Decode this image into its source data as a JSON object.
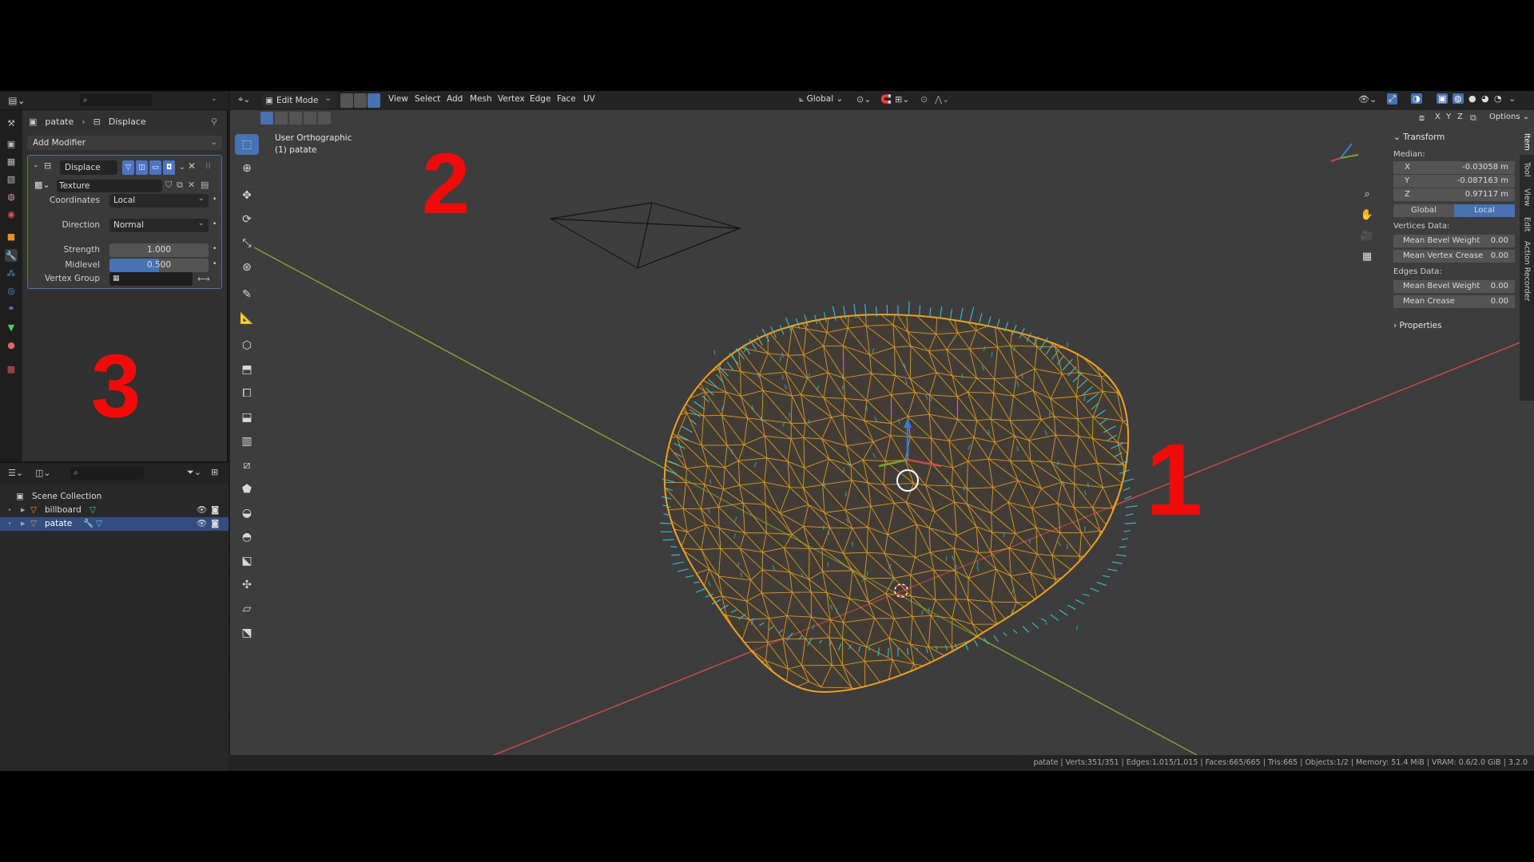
{
  "properties": {
    "breadcrumb": {
      "object": "patate",
      "modifier": "Displace"
    },
    "add_modifier_label": "Add Modifier",
    "modifier": {
      "name": "Displace",
      "texture_label": "Texture",
      "coordinates_label": "Coordinates",
      "coordinates_value": "Local",
      "direction_label": "Direction",
      "direction_value": "Normal",
      "strength_label": "Strength",
      "strength_value": "1.000",
      "midlevel_label": "Midlevel",
      "midlevel_value": "0.500",
      "midlevel_fraction": 0.5,
      "vertex_group_label": "Vertex Group"
    }
  },
  "outliner": {
    "scene_collection": "Scene Collection",
    "items": [
      {
        "name": "billboard",
        "selected": false
      },
      {
        "name": "patate",
        "selected": true
      }
    ]
  },
  "viewport": {
    "mode": "Edit Mode",
    "menus": [
      "View",
      "Select",
      "Add",
      "Mesh",
      "Vertex",
      "Edge",
      "Face",
      "UV"
    ],
    "transform_orientation": "Global",
    "options_label": "Options",
    "axis_labels": [
      "X",
      "Y",
      "Z"
    ],
    "view_name": "User Orthographic",
    "object_label": "(1) patate"
  },
  "annotations": {
    "one": "1",
    "two": "2",
    "three": "3"
  },
  "npanel": {
    "transform_header": "Transform",
    "median_label": "Median:",
    "x_label": "X",
    "x_value": "-0.03058 m",
    "y_label": "Y",
    "y_value": "-0.087163 m",
    "z_label": "Z",
    "z_value": "0.97117 m",
    "global_label": "Global",
    "local_label": "Local",
    "vertices_data_label": "Vertices Data:",
    "mean_bevel_weight_label": "Mean Bevel Weight",
    "mean_bevel_weight_value": "0.00",
    "mean_vertex_crease_label": "Mean Vertex Crease",
    "mean_vertex_crease_value": "0.00",
    "edges_data_label": "Edges Data:",
    "edge_bevel_weight_label": "Mean Bevel Weight",
    "edge_bevel_weight_value": "0.00",
    "mean_crease_label": "Mean Crease",
    "mean_crease_value": "0.00",
    "properties_label": "Properties",
    "side_tabs": [
      "Item",
      "Tool",
      "View",
      "Edit",
      "Action Recorder"
    ]
  },
  "statusbar": {
    "text": "patate | Verts:351/351 | Edges:1,015/1,015 | Faces:665/665 | Tris:665 | Objects:1/2 | Memory: 51.4 MiB | VRAM: 0.6/2.0 GiB | 3.2.0"
  },
  "colors": {
    "accent": "#4772b3",
    "wire": "#f0a020",
    "normals": "#35c3d0",
    "annotation": "#f20a0a",
    "x_axis": "#c84a4a",
    "y_axis": "#7ea032"
  }
}
